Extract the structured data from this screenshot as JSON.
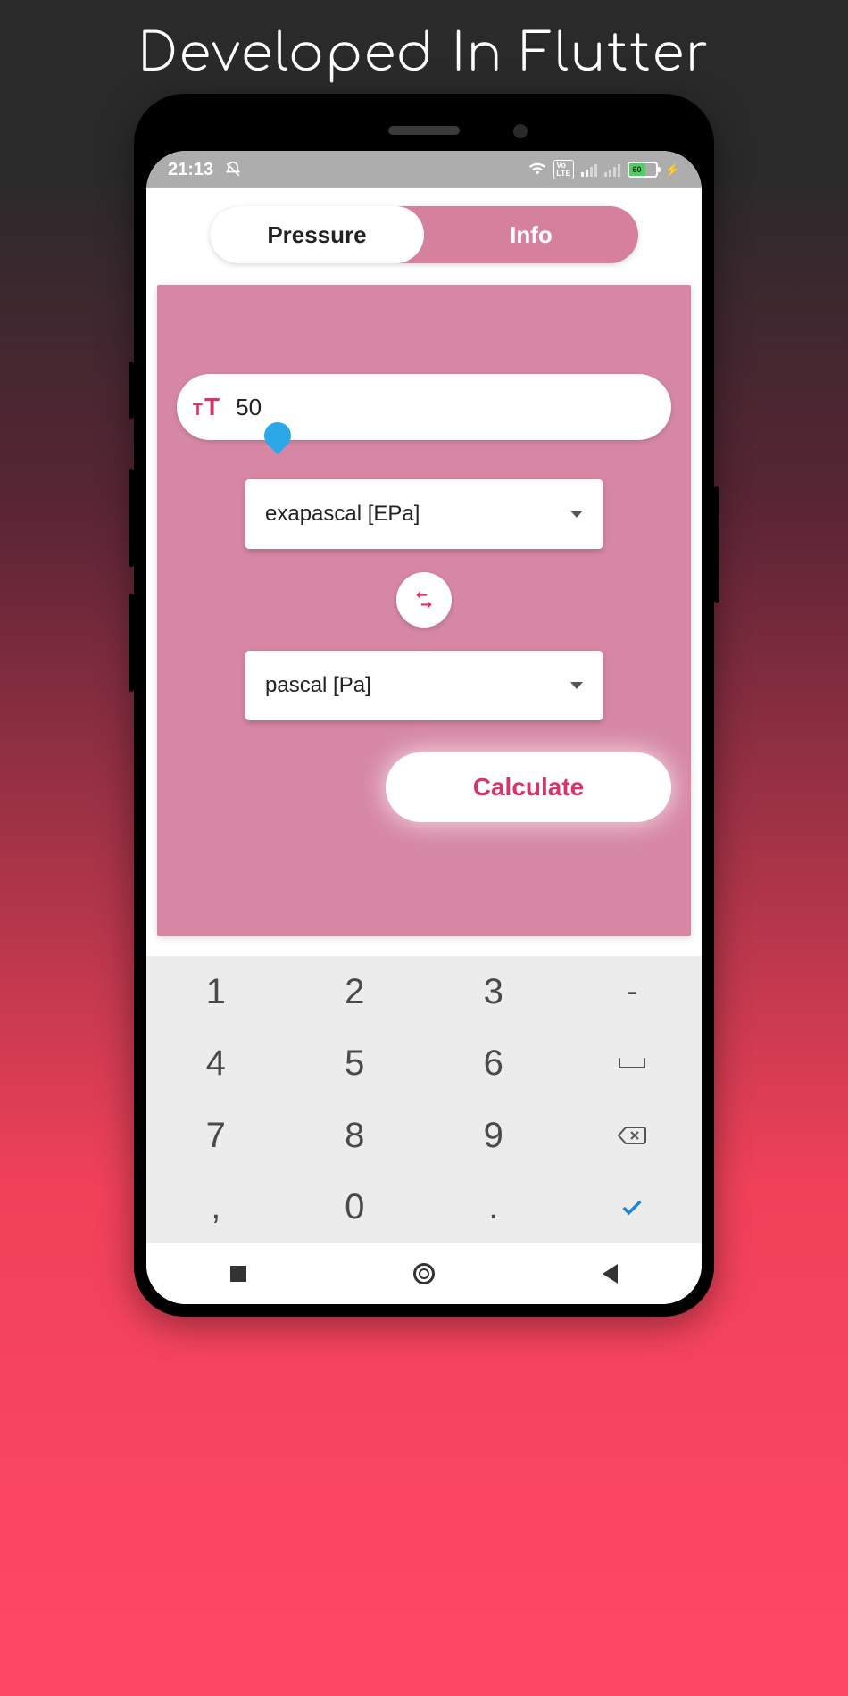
{
  "headline": "Developed In Flutter",
  "status": {
    "time": "21:13",
    "battery_pct": "60"
  },
  "tabs": {
    "active": "Pressure",
    "inactive": "Info"
  },
  "input": {
    "value": "50"
  },
  "select_from": "exapascal [EPa]",
  "select_to": "pascal [Pa]",
  "calculate_label": "Calculate",
  "keypad": {
    "r1": [
      "1",
      "2",
      "3",
      "-"
    ],
    "r2": [
      "4",
      "5",
      "6",
      "⌴"
    ],
    "r3": [
      "7",
      "8",
      "9",
      "bksp"
    ],
    "r4": [
      ",",
      "0",
      ".",
      "✓"
    ]
  }
}
